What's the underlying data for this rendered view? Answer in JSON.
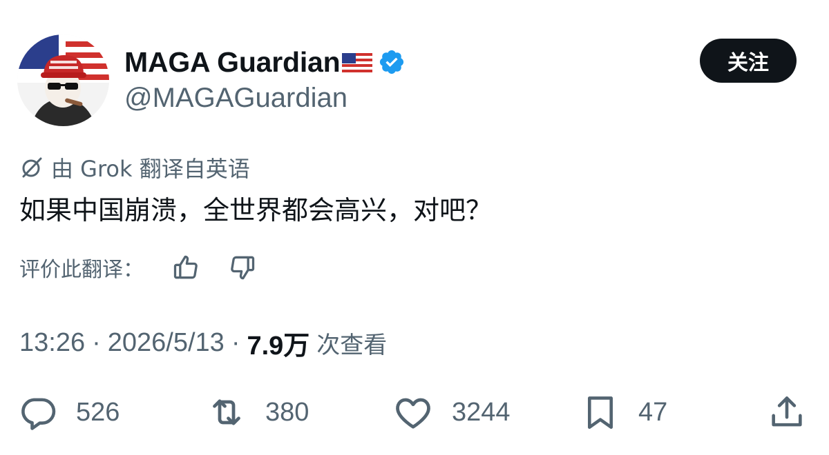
{
  "author": {
    "display_name": "MAGA Guardian",
    "handle": "@MAGAGuardian",
    "icons": [
      "us-flag-icon",
      "verified-badge-icon"
    ],
    "colors": {
      "verified": "#1d9bf0"
    }
  },
  "follow_button": {
    "label": "关注"
  },
  "translation": {
    "notice": "由 Grok 翻译自英语"
  },
  "tweet": {
    "text": "如果中国崩溃，全世界都会高兴，对吧？"
  },
  "rate_translation": {
    "label": "评价此翻译："
  },
  "meta": {
    "time": "13:26",
    "date": "2026/5/13",
    "separator": "·",
    "views_count": "7.9万",
    "views_label": "次查看"
  },
  "actions": {
    "reply_count": "526",
    "retweet_count": "380",
    "like_count": "3244",
    "bookmark_count": "47"
  }
}
